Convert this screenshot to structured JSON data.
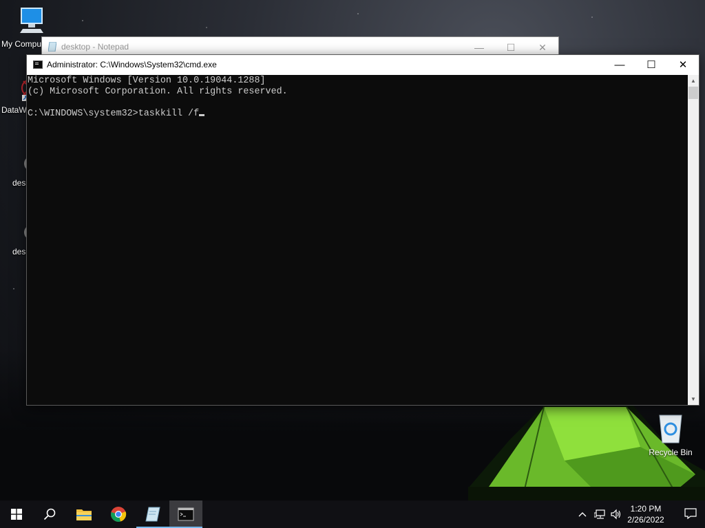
{
  "desktop": {
    "icons": [
      {
        "label": "My Computer",
        "visible_label": "My Compu"
      },
      {
        "label": "DataW",
        "visible_label": "DataW"
      },
      {
        "label": "desl",
        "visible_label": "desl"
      },
      {
        "label": "desl",
        "visible_label": "desl"
      },
      {
        "label": "Recycle Bin",
        "visible_label": "Recycle Bin"
      }
    ]
  },
  "notepad": {
    "title": "desktop - Notepad",
    "minimize": "—",
    "maximize": "☐",
    "close": "✕"
  },
  "cmd": {
    "title": "Administrator: C:\\Windows\\System32\\cmd.exe",
    "minimize": "—",
    "maximize": "☐",
    "close": "✕",
    "lines": [
      "Microsoft Windows [Version 10.0.19044.1288]",
      "(c) Microsoft Corporation. All rights reserved.",
      "",
      "C:\\WINDOWS\\system32>taskkill /f"
    ],
    "console_bg": "#0c0c0c",
    "console_fg": "#cccccc"
  },
  "taskbar": {
    "items": [
      {
        "name": "start",
        "icon": "windows-logo-icon"
      },
      {
        "name": "search",
        "icon": "search-icon"
      },
      {
        "name": "file-explorer",
        "icon": "folder-icon"
      },
      {
        "name": "chrome",
        "icon": "chrome-icon"
      },
      {
        "name": "notepad",
        "icon": "notepad-icon"
      },
      {
        "name": "cmd",
        "icon": "cmd-icon"
      }
    ],
    "tray": {
      "chevron": "^",
      "time": "1:20 PM",
      "date": "2/26/2022"
    },
    "accent": "#76b9ed"
  }
}
